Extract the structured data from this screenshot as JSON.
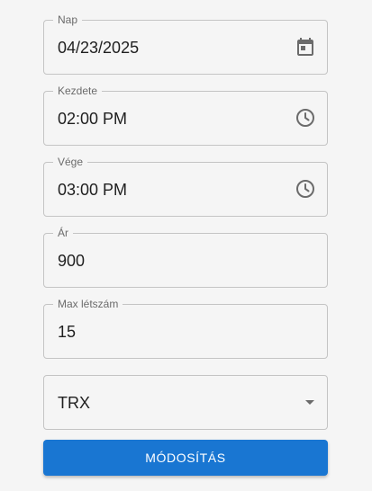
{
  "form": {
    "fields": [
      {
        "label": "Nap",
        "value": "04/23/2025",
        "icon": "calendar-icon"
      },
      {
        "label": "Kezdete",
        "value": "02:00 PM",
        "icon": "clock-icon"
      },
      {
        "label": "Vége",
        "value": "03:00 PM",
        "icon": "clock-icon"
      },
      {
        "label": "Ár",
        "value": "900"
      },
      {
        "label": "Max létszám",
        "value": "15"
      }
    ],
    "select": {
      "value": "TRX",
      "icon": "dropdown-arrow-icon"
    },
    "submit_label": "MÓDOSÍTÁS"
  },
  "colors": {
    "accent": "#1976d2",
    "border": "#c4c4c4",
    "background": "#f5f5f5"
  }
}
